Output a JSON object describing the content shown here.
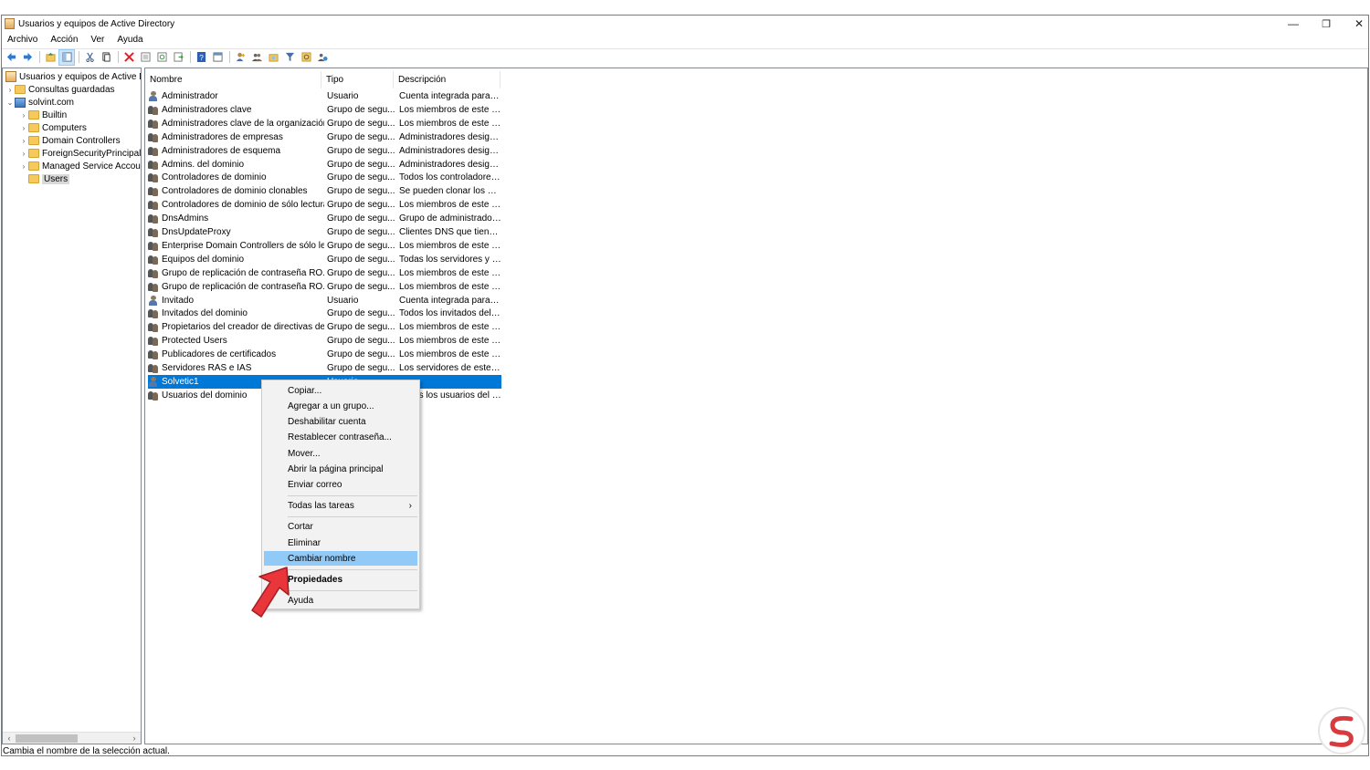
{
  "window": {
    "title": "Usuarios y equipos de Active Directory",
    "controls": {
      "minimize": "—",
      "restore": "❐",
      "close": "✕"
    }
  },
  "menu": [
    "Archivo",
    "Acción",
    "Ver",
    "Ayuda"
  ],
  "toolbar_icons": [
    "back-icon",
    "forward-icon",
    "up-folder-icon",
    "console-tree-icon",
    "cut-icon",
    "copy-icon",
    "delete-icon",
    "properties-icon",
    "refresh-icon",
    "export-icon",
    "help-icon",
    "view-icon",
    "add-user-icon",
    "add-group-icon",
    "add-ou-icon",
    "filter-icon",
    "find-icon",
    "add-to-group-icon"
  ],
  "tree": {
    "root": "Usuarios y equipos de Active Directory [DC.solvint.com]",
    "saved_queries": "Consultas guardadas",
    "domain": "solvint.com",
    "children": [
      "Builtin",
      "Computers",
      "Domain Controllers",
      "ForeignSecurityPrincipals",
      "Managed Service Accounts",
      "Users"
    ],
    "selected": "Users"
  },
  "columns": [
    "Nombre",
    "Tipo",
    "Descripción"
  ],
  "rows": [
    {
      "name": "Administrador",
      "type": "Usuario",
      "desc": "Cuenta integrada para la...",
      "icon": "user"
    },
    {
      "name": "Administradores clave",
      "type": "Grupo de segu...",
      "desc": "Los miembros de este gr...",
      "icon": "group"
    },
    {
      "name": "Administradores clave de la organización",
      "type": "Grupo de segu...",
      "desc": "Los miembros de este gr...",
      "icon": "group"
    },
    {
      "name": "Administradores de empresas",
      "type": "Grupo de segu...",
      "desc": "Administradores design...",
      "icon": "group"
    },
    {
      "name": "Administradores de esquema",
      "type": "Grupo de segu...",
      "desc": "Administradores design...",
      "icon": "group"
    },
    {
      "name": "Admins. del dominio",
      "type": "Grupo de segu...",
      "desc": "Administradores design...",
      "icon": "group"
    },
    {
      "name": "Controladores de dominio",
      "type": "Grupo de segu...",
      "desc": "Todos los controladores ...",
      "icon": "group"
    },
    {
      "name": "Controladores de dominio clonables",
      "type": "Grupo de segu...",
      "desc": "Se pueden clonar los mi...",
      "icon": "group"
    },
    {
      "name": "Controladores de dominio de sólo lectura",
      "type": "Grupo de segu...",
      "desc": "Los miembros de este gr...",
      "icon": "group"
    },
    {
      "name": "DnsAdmins",
      "type": "Grupo de segu...",
      "desc": "Grupo de administrador...",
      "icon": "group"
    },
    {
      "name": "DnsUpdateProxy",
      "type": "Grupo de segu...",
      "desc": "Clientes DNS que tienen...",
      "icon": "group"
    },
    {
      "name": "Enterprise Domain Controllers de sólo le...",
      "type": "Grupo de segu...",
      "desc": "Los miembros de este gr...",
      "icon": "group"
    },
    {
      "name": "Equipos del dominio",
      "type": "Grupo de segu...",
      "desc": "Todas los servidores y es...",
      "icon": "group"
    },
    {
      "name": "Grupo de replicación de contraseña RO...",
      "type": "Grupo de segu...",
      "desc": "Los miembros de este gr...",
      "icon": "group"
    },
    {
      "name": "Grupo de replicación de contraseña RO...",
      "type": "Grupo de segu...",
      "desc": "Los miembros de este gr...",
      "icon": "group"
    },
    {
      "name": "Invitado",
      "type": "Usuario",
      "desc": "Cuenta integrada para el...",
      "icon": "user"
    },
    {
      "name": "Invitados del dominio",
      "type": "Grupo de segu...",
      "desc": "Todos los invitados del d...",
      "icon": "group"
    },
    {
      "name": "Propietarios del creador de directivas de...",
      "type": "Grupo de segu...",
      "desc": "Los miembros de este gr...",
      "icon": "group"
    },
    {
      "name": "Protected Users",
      "type": "Grupo de segu...",
      "desc": "Los miembros de este gr...",
      "icon": "group"
    },
    {
      "name": "Publicadores de certificados",
      "type": "Grupo de segu...",
      "desc": "Los miembros de este gr...",
      "icon": "group"
    },
    {
      "name": "Servidores RAS e IAS",
      "type": "Grupo de segu...",
      "desc": "Los servidores de este gr...",
      "icon": "group"
    },
    {
      "name": "Solvetic1",
      "type": "Usuario",
      "desc": "",
      "icon": "user",
      "selected": true
    },
    {
      "name": "Usuarios del dominio",
      "type": "Grupo de segu...",
      "desc": "Todos los usuarios del d...",
      "icon": "group"
    }
  ],
  "context_menu": [
    {
      "label": "Copiar..."
    },
    {
      "label": "Agregar a un grupo..."
    },
    {
      "label": "Deshabilitar cuenta"
    },
    {
      "label": "Restablecer contraseña..."
    },
    {
      "label": "Mover..."
    },
    {
      "label": "Abrir la página principal"
    },
    {
      "label": "Enviar correo"
    },
    {
      "separator": true
    },
    {
      "label": "Todas las tareas",
      "submenu": true
    },
    {
      "separator": true
    },
    {
      "label": "Cortar"
    },
    {
      "label": "Eliminar"
    },
    {
      "label": "Cambiar nombre",
      "highlighted": true
    },
    {
      "separator": true
    },
    {
      "label": "Propiedades",
      "bold": true
    },
    {
      "separator": true
    },
    {
      "label": "Ayuda"
    }
  ],
  "status": "Cambia el nombre de la selección actual.",
  "colors": {
    "selection": "#0078d7",
    "menu_highlight": "#91c9f7",
    "arrow": "#e8363b",
    "logo": "#d93a3f"
  }
}
